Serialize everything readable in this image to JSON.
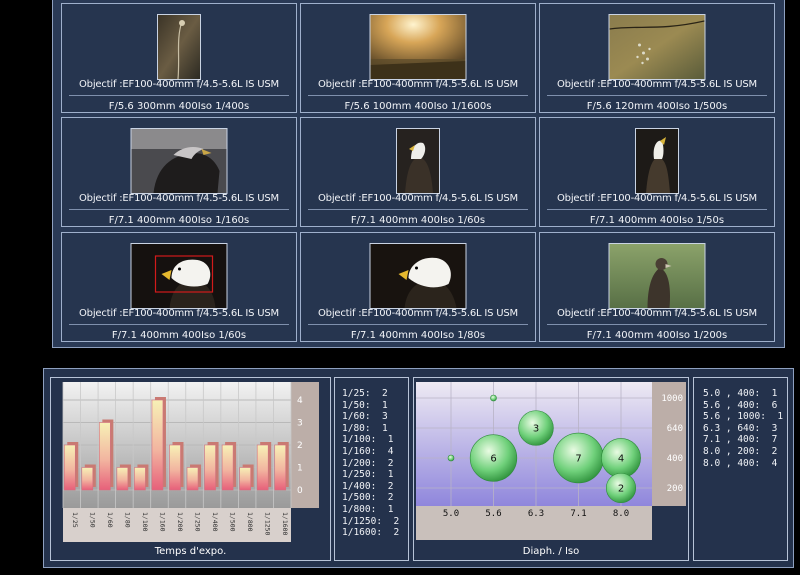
{
  "gallery": {
    "items": [
      {
        "lens": "Objectif :EF100-400mm f/4.5-5.6L IS USM",
        "settings": "F/5.6 300mm 400Iso 1/400s",
        "photo": "plant-stem"
      },
      {
        "lens": "Objectif :EF100-400mm f/4.5-5.6L IS USM",
        "settings": "F/5.6 100mm 400Iso 1/1600s",
        "photo": "sunlit-meadow"
      },
      {
        "lens": "Objectif :EF100-400mm f/4.5-5.6L IS USM",
        "settings": "F/5.6 120mm 400Iso 1/500s",
        "photo": "dew-twig"
      },
      {
        "lens": "Objectif :EF100-400mm f/4.5-5.6L IS USM",
        "settings": "F/7.1 400mm 400Iso 1/160s",
        "photo": "eagle-profile"
      },
      {
        "lens": "Objectif :EF100-400mm f/4.5-5.6L IS USM",
        "settings": "F/7.1 400mm 400Iso 1/60s",
        "photo": "eagle-portrait"
      },
      {
        "lens": "Objectif :EF100-400mm f/4.5-5.6L IS USM",
        "settings": "F/7.1 400mm 400Iso 1/50s",
        "photo": "eagle-portrait-2"
      },
      {
        "lens": "Objectif :EF100-400mm f/4.5-5.6L IS USM",
        "settings": "F/7.1 400mm 400Iso 1/60s",
        "photo": "eagle-head-selected"
      },
      {
        "lens": "Objectif :EF100-400mm f/4.5-5.6L IS USM",
        "settings": "F/7.1 400mm 400Iso 1/80s",
        "photo": "eagle-head"
      },
      {
        "lens": "Objectif :EF100-400mm f/4.5-5.6L IS USM",
        "settings": "F/7.1 400mm 400Iso 1/200s",
        "photo": "hawk-grass"
      }
    ]
  },
  "exposure_chart": {
    "title": "Temps d'expo.",
    "categories": [
      "1/25",
      "1/50",
      "1/60",
      "1/80",
      "1/100",
      "1/160",
      "1/200",
      "1/250",
      "1/400",
      "1/500",
      "1/800",
      "1/1250",
      "1/1600"
    ],
    "values": [
      2,
      1,
      3,
      1,
      1,
      4,
      2,
      1,
      2,
      2,
      1,
      2,
      2
    ],
    "yticks": [
      "4",
      "3",
      "2",
      "1",
      "0"
    ]
  },
  "exposure_list": [
    "1/25:  2",
    "1/50:  1",
    "1/60:  3",
    "1/80:  1",
    "1/100:  1",
    "1/160:  4",
    "1/200:  2",
    "1/250:  1",
    "1/400:  2",
    "1/500:  2",
    "1/800:  1",
    "1/1250:  2",
    "1/1600:  2"
  ],
  "aperture_chart": {
    "title": "Diaph. / Iso",
    "xticks": [
      "5.0",
      "5.6",
      "6.3",
      "7.1",
      "8.0"
    ],
    "yticks": [
      "1000",
      "640",
      "400",
      "200"
    ],
    "points": [
      {
        "x": "5.6",
        "y": "1000",
        "n": 1
      },
      {
        "x": "6.3",
        "y": "640",
        "n": 3
      },
      {
        "x": "5.0",
        "y": "400",
        "n": 1
      },
      {
        "x": "5.6",
        "y": "400",
        "n": 6
      },
      {
        "x": "7.1",
        "y": "400",
        "n": 7
      },
      {
        "x": "8.0",
        "y": "400",
        "n": 4
      },
      {
        "x": "8.0",
        "y": "200",
        "n": 2
      }
    ]
  },
  "aperture_list": [
    "5.0 , 400:  1",
    "5.6 , 400:  6",
    "5.6 , 1000:  1",
    "6.3 , 640:  3",
    "7.1 , 400:  7",
    "8.0 , 200:  2",
    "8.0 , 400:  4"
  ],
  "chart_data": [
    {
      "type": "bar",
      "title": "",
      "xlabel": "Temps d'expo.",
      "ylabel": "",
      "categories": [
        "1/25",
        "1/50",
        "1/60",
        "1/80",
        "1/100",
        "1/160",
        "1/200",
        "1/250",
        "1/400",
        "1/500",
        "1/800",
        "1/1250",
        "1/1600"
      ],
      "values": [
        2,
        1,
        3,
        1,
        1,
        4,
        2,
        1,
        2,
        2,
        1,
        2,
        2
      ],
      "ylim": [
        0,
        4
      ]
    },
    {
      "type": "scatter",
      "title": "",
      "xlabel": "Diaph. / Iso",
      "ylabel": "",
      "x_categories": [
        "5.0",
        "5.6",
        "6.3",
        "7.1",
        "8.0"
      ],
      "y_categories": [
        "200",
        "400",
        "640",
        "1000"
      ],
      "points": [
        {
          "x": 5.6,
          "y": 1000,
          "count": 1
        },
        {
          "x": 6.3,
          "y": 640,
          "count": 3
        },
        {
          "x": 5.0,
          "y": 400,
          "count": 1
        },
        {
          "x": 5.6,
          "y": 400,
          "count": 6
        },
        {
          "x": 7.1,
          "y": 400,
          "count": 7
        },
        {
          "x": 8.0,
          "y": 400,
          "count": 4
        },
        {
          "x": 8.0,
          "y": 200,
          "count": 2
        }
      ]
    }
  ]
}
